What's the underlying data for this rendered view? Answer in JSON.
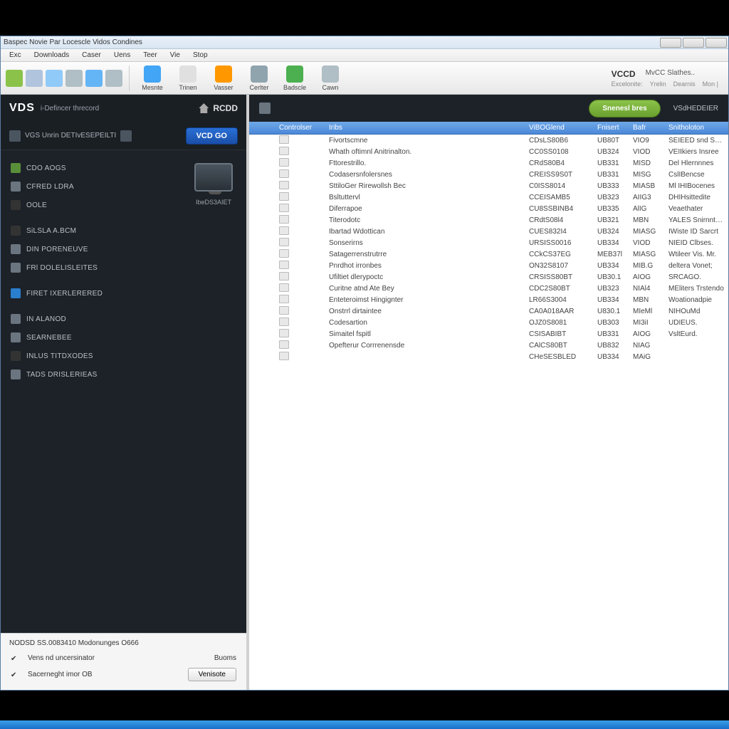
{
  "titlebar": "Baspec Novie Par Locescle Vidos Condines",
  "menu": [
    "Exc",
    "Downloads",
    "Caser",
    "Uens",
    "Teer",
    "Vie",
    "Stop"
  ],
  "toolbar": {
    "small_icons": [
      {
        "name": "new-icon",
        "color": "#8bc34a"
      },
      {
        "name": "open-icon",
        "color": "#b0c4de"
      },
      {
        "name": "save-icon",
        "color": "#90caf9"
      },
      {
        "name": "copy-icon",
        "color": "#b0bec5"
      },
      {
        "name": "list-icon",
        "color": "#64b5f6"
      },
      {
        "name": "print-icon",
        "color": "#b0bec5"
      }
    ],
    "big": [
      {
        "name": "mesnte",
        "label": "Mesnte",
        "color": "#42a5f5"
      },
      {
        "name": "trinen",
        "label": "Trinen",
        "color": "#e0e0e0"
      },
      {
        "name": "vasser",
        "label": "Vasser",
        "color": "#ff9800"
      },
      {
        "name": "cerlter",
        "label": "Cerlter",
        "color": "#90a4ae"
      },
      {
        "name": "badscle",
        "label": "Badscle",
        "color": "#4caf50"
      },
      {
        "name": "cawn",
        "label": "Cawn",
        "color": "#b0bec5"
      }
    ],
    "right": {
      "brand": "VCCD",
      "status": "MvCC Slathes..",
      "sub": [
        "Excelonite:",
        "Yrelin",
        "Dearnis",
        "Mon |"
      ]
    }
  },
  "sidebar": {
    "brand": "VDS",
    "brand_sub": "i-Defincer threcord",
    "hdr_right": "RCDD",
    "sub_left": "VGS   Unrin DETIvESEPEILTI",
    "go_btn": "VCD GO",
    "device_label": "IbeDS3AIET",
    "nav": [
      {
        "name": "cdo-dogs",
        "label": "CDO AOGS",
        "color": "#5a8f3a"
      },
      {
        "name": "cfred-ldra",
        "label": "CFRED LDRA",
        "color": "#6a7580"
      },
      {
        "name": "oole",
        "label": "OOLE",
        "color": "#333"
      },
      {
        "name": "silsla-a-bcm",
        "label": "SiLSLA A.BCM",
        "color": "#333"
      },
      {
        "name": "din-poreinuve",
        "label": "DIN PORENEUVE",
        "color": "#6a7580"
      },
      {
        "name": "frl-doleisleites",
        "label": "FRl DOLELISLEITES",
        "color": "#6a7580"
      },
      {
        "name": "firet-ixerlerred",
        "label": "FIRET IXERLERERED",
        "color": "#2a7fcf"
      },
      {
        "name": "in-alanod",
        "label": "IN ALANOD",
        "color": "#6a7580"
      },
      {
        "name": "searnebee",
        "label": "SEARNEBEE",
        "color": "#6a7580"
      },
      {
        "name": "inlus-titdxodes",
        "label": "INLUS TITDXODES",
        "color": "#333"
      },
      {
        "name": "tads-drislerieas",
        "label": "TADS DRISLERIEAS",
        "color": "#6a7580"
      }
    ],
    "footer": {
      "title": "NODSD SS.0083410 Modonunges O666",
      "rows": [
        {
          "label": "Vens nd uncersinator",
          "btn": "Buoms",
          "btn_style": "text"
        },
        {
          "label": "Sacerneght imor OB",
          "btn": "Venisote",
          "btn_style": "button"
        }
      ]
    }
  },
  "main": {
    "shared_btn": "Snenesl bres",
    "hdr_right": "VSdHEDEIER",
    "columns": [
      "",
      "Controlser",
      "Iribs",
      "",
      "ViBOGlend",
      "Fnisert",
      "Bafr",
      "Snitholoton"
    ],
    "rows": [
      {
        "n": "Fivortscmne",
        "v1": "CDsLS80B6",
        "v2": "UB80T",
        "v3": "VIO9",
        "s": "SEIEED snd Spad"
      },
      {
        "n": "Whath oftimnl Anitrinalton.",
        "v1": "CC0SS0108",
        "v2": "UB324",
        "v3": "VIOD",
        "s": "VEIIkiers Insree"
      },
      {
        "n": "Fttorestrillo.",
        "v1": "CRdS80B4",
        "v2": "UB331",
        "v3": "MISD",
        "s": "Del Hlernnnes"
      },
      {
        "n": "Codasersnfolersnes",
        "v1": "CREISS9S0T",
        "v2": "UB331",
        "v3": "MISG",
        "s": "CslIBencse"
      },
      {
        "n": "SttiloGer Rirewollsh Bec",
        "v1": "C0ISS8014",
        "v2": "UB333",
        "v3": "MIASB",
        "s": "Ml IHIBocenes"
      },
      {
        "n": "Bsltuttervl",
        "v1": "CCEISAMB5",
        "v2": "UB323",
        "v3": "AIIG3",
        "s": "DHIHsittedite"
      },
      {
        "n": "Diferrapoe",
        "v1": "CU8SSBINB4",
        "v2": "UB335",
        "v3": "AlIG",
        "s": "Veaethater"
      },
      {
        "n": "Titerodotc",
        "v1": "CRdtS08l4",
        "v2": "UB321",
        "v3": "MBN",
        "s": "YALES Snirnnt Om"
      },
      {
        "n": "Ibartad Wdottican",
        "v1": "CUES832I4",
        "v2": "UB324",
        "v3": "MIASG",
        "s": "IWiste ID Sarcrt"
      },
      {
        "n": "Sonserirns",
        "v1": "URSISS0016",
        "v2": "UB334",
        "v3": "VIOD",
        "s": "NIEID Clbses."
      },
      {
        "n": "Satagerrenstrutrre",
        "v1": "CCkCS37EG",
        "v2": "MEB37l",
        "v3": "MIASG",
        "s": "Wtileer Vis. Mr."
      },
      {
        "n": "Pnrdhot irronbes",
        "v1": "ON32S8107",
        "v2": "UB334",
        "v3": "MIB.G",
        "s": "deltera Vonet;"
      },
      {
        "n": "Ufiltiet dlerypoctc",
        "v1": "CRSISS80BT",
        "v2": "UB30.1",
        "v3": "AIOG",
        "s": "SRCAGO."
      },
      {
        "n": "Curitne atnd Ate Bey",
        "v1": "CDC2S80BT",
        "v2": "UB323",
        "v3": "NIAl4",
        "s": "MEliters Trstendo"
      },
      {
        "n": "Enteteroimst Hingignter",
        "v1": "LR66S3004",
        "v2": "UB334",
        "v3": "MBN",
        "s": "Woationadpie"
      },
      {
        "n": "Onstrrl dirtaintee",
        "v1": "CA0A018AAR",
        "v2": "U830.1",
        "v3": "MIeMl",
        "s": "NIHOuMd"
      },
      {
        "n": "Codesartion",
        "v1": "OJZ0S8081",
        "v2": "UB303",
        "v3": "MI3iI",
        "s": "UDIEUS."
      },
      {
        "n": "Simaitel fspitl",
        "v1": "CSISABIBT",
        "v2": "UB331",
        "v3": "AIOG",
        "s": "VsltEurd."
      },
      {
        "n": "Opefterur Corrrenensde",
        "v1": "CAlCS80BT",
        "v2": "UB832",
        "v3": "NIAG",
        "s": ""
      },
      {
        "n": "",
        "v1": "CHeSESBLED",
        "v2": "UB334",
        "v3": "MAiG",
        "s": ""
      }
    ]
  }
}
